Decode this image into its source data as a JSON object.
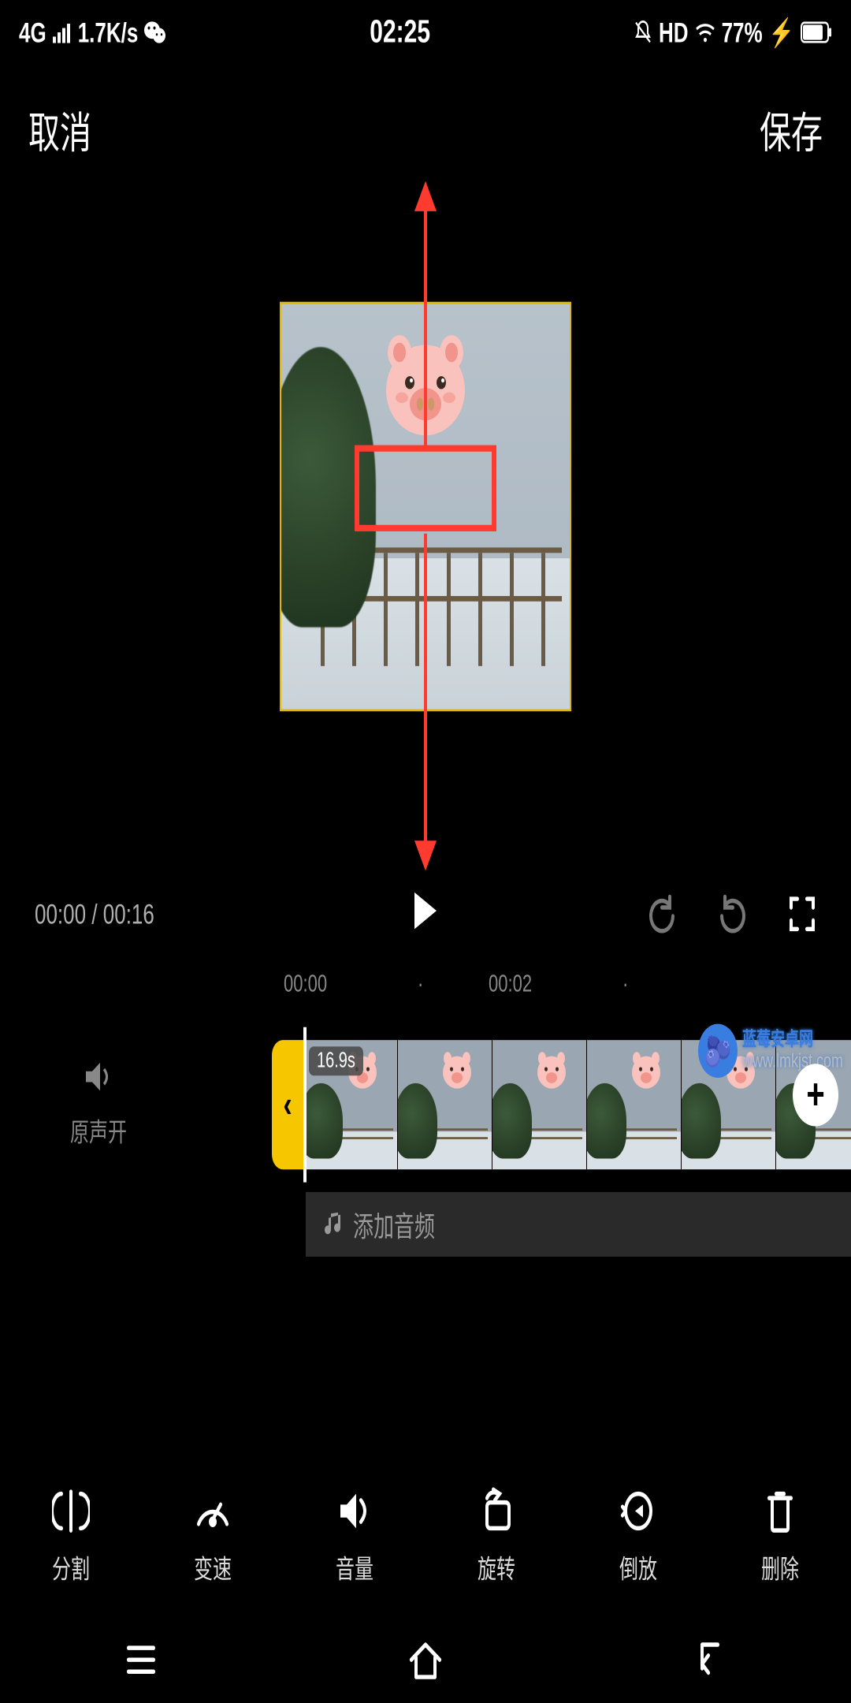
{
  "statusbar": {
    "network": "4G",
    "speed": "1.7K/s",
    "time": "02:25",
    "hd": "HD",
    "battery": "77%"
  },
  "topbar": {
    "cancel": "取消",
    "save": "保存"
  },
  "playback": {
    "current": "00:00",
    "sep": "/",
    "total": "00:16"
  },
  "ruler": {
    "t0": "00:00",
    "dot": "·",
    "t2": "00:02"
  },
  "track": {
    "original_sound": "原声开",
    "duration_badge": "16.9s",
    "handle_glyph": "‹"
  },
  "audio": {
    "add_label": "添加音频"
  },
  "tools": {
    "split": "分割",
    "speed": "变速",
    "volume": "音量",
    "rotate": "旋转",
    "reverse": "倒放",
    "delete": "删除"
  },
  "watermark": {
    "title": "蓝莓安卓网",
    "url": "www.lmkjst.com"
  },
  "icons": {
    "wechat": "wechat-icon",
    "bell_off": "bell-off-icon",
    "wifi": "wifi-icon",
    "battery": "battery-icon",
    "play": "play-icon",
    "undo": "undo-icon",
    "redo": "redo-icon",
    "fullscreen": "fullscreen-icon",
    "speaker": "speaker-icon",
    "music_note": "music-note-icon",
    "plus": "plus-icon",
    "menu": "menu-icon",
    "home": "home-icon",
    "back": "back-icon"
  }
}
